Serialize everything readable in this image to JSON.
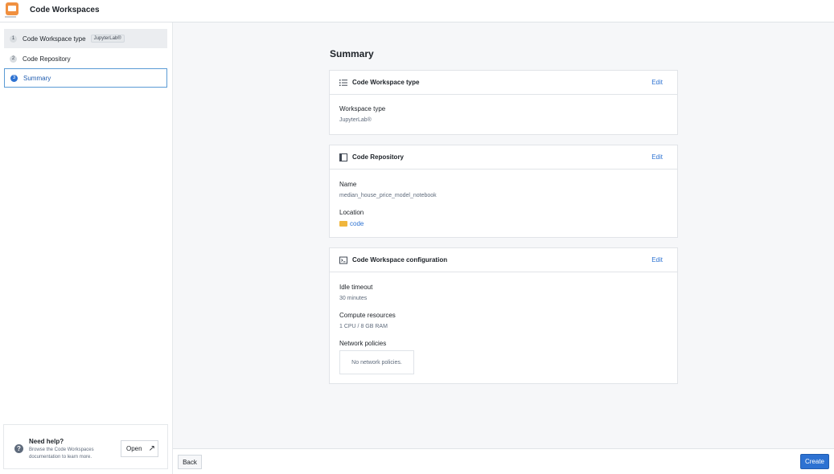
{
  "header": {
    "title": "Code Workspaces",
    "logo_icon": "code-workspaces-logo-icon"
  },
  "sidebar": {
    "steps": [
      {
        "number": "1",
        "label": "Code Workspace type",
        "tag": "JupyterLab®"
      },
      {
        "number": "2",
        "label": "Code Repository"
      },
      {
        "number": "3",
        "label": "Summary"
      }
    ],
    "help": {
      "title": "Need help?",
      "text": "Browse the Code Workspaces documentation to learn more.",
      "open_label": "Open",
      "icon": "help-question-icon"
    }
  },
  "main": {
    "title": "Summary",
    "cards": {
      "workspace_type": {
        "title": "Code Workspace type",
        "edit_label": "Edit",
        "icon": "list-icon",
        "fields": {
          "type_label": "Workspace type",
          "type_value": "JupyterLab®"
        }
      },
      "repository": {
        "title": "Code Repository",
        "edit_label": "Edit",
        "icon": "repository-icon",
        "fields": {
          "name_label": "Name",
          "name_value": "median_house_price_model_notebook",
          "location_label": "Location",
          "location_value": "code"
        }
      },
      "configuration": {
        "title": "Code Workspace configuration",
        "edit_label": "Edit",
        "icon": "terminal-window-icon",
        "fields": {
          "idle_label": "Idle timeout",
          "idle_value": "30 minutes",
          "compute_label": "Compute resources",
          "compute_value": "1 CPU / 8 GB RAM",
          "network_label": "Network policies",
          "network_value": "No network policies."
        }
      }
    }
  },
  "footer": {
    "back_label": "Back",
    "create_label": "Create"
  },
  "colors": {
    "accent": "#2d72d2",
    "logo": "#f09040",
    "folder": "#f0b63d"
  }
}
